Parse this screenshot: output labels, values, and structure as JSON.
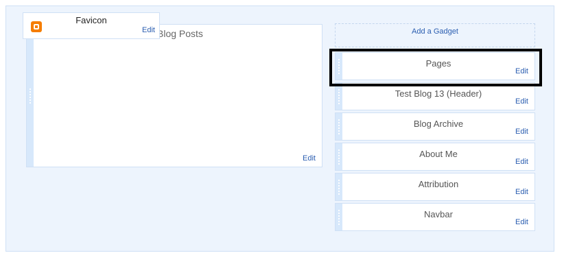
{
  "favicon": {
    "title": "Favicon",
    "edit": "Edit",
    "logo_icon": "blogger-icon",
    "logo_color": "#f57d00"
  },
  "main": {
    "title": "Blog Posts",
    "edit": "Edit"
  },
  "sidebar": {
    "add_gadget": "Add a Gadget",
    "gadgets": [
      {
        "title": "Pages",
        "edit": "Edit",
        "selected": true
      },
      {
        "title": "Test Blog 13 (Header)",
        "edit": "Edit"
      },
      {
        "title": "Blog Archive",
        "edit": "Edit"
      },
      {
        "title": "About Me",
        "edit": "Edit"
      },
      {
        "title": "Attribution",
        "edit": "Edit"
      },
      {
        "title": "Navbar",
        "edit": "Edit"
      }
    ]
  },
  "colors": {
    "link": "#2a5db0",
    "handle": "#d7e8fb",
    "layout_bg": "#edf4fd"
  }
}
